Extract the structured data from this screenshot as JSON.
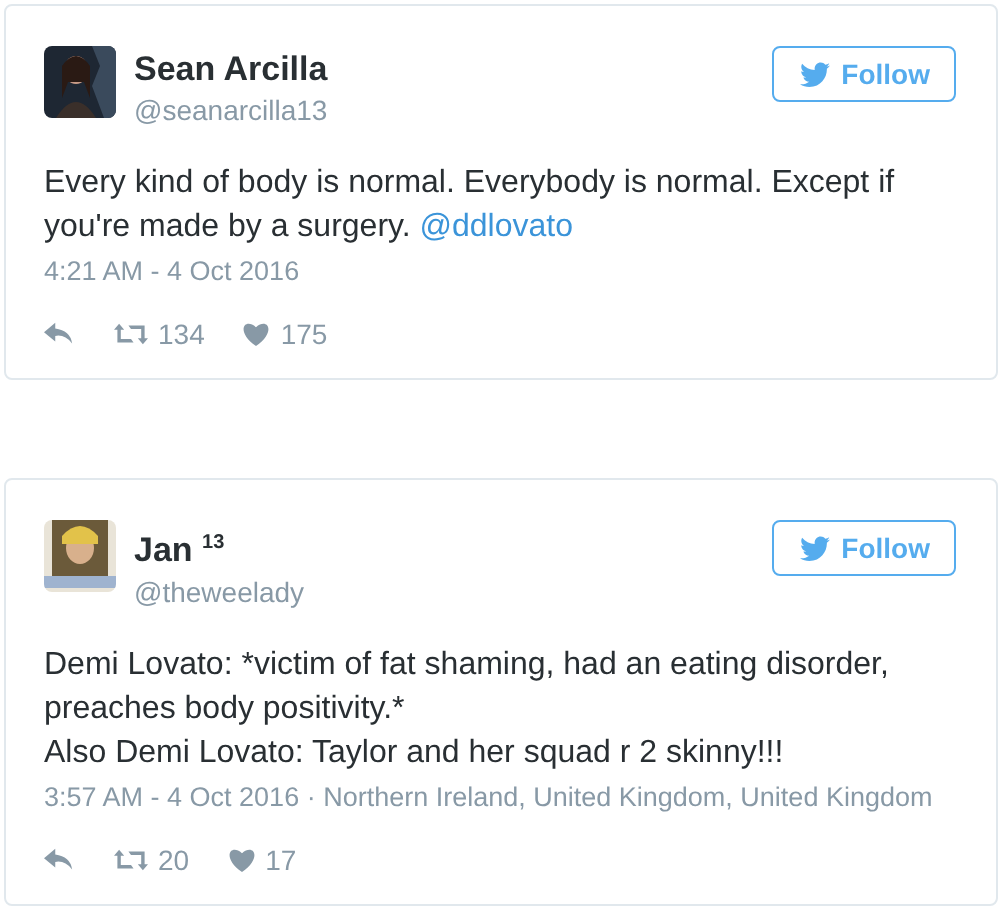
{
  "tweets": [
    {
      "name": "Sean Arcilla",
      "handle": "@seanarcilla13",
      "follow": "Follow",
      "paragraphs": [
        "Every kind of body is normal. Everybody is normal. Except if you're made by a surgery."
      ],
      "mention": "@ddlovato",
      "meta": "4:21 AM - 4 Oct 2016",
      "retweets": "134",
      "likes": "175"
    },
    {
      "name": "Jan $^{13}$",
      "handle": "@theweelady",
      "follow": "Follow",
      "paragraphs": [
        "Demi Lovato: *victim of fat shaming, had an eating disorder, preaches body positivity.*",
        "Also Demi Lovato: Taylor and her squad r 2 skinny!!!"
      ],
      "meta": "3:57 AM - 4 Oct 2016 · Northern Ireland, United Kingdom, United Kingdom",
      "retweets": "20",
      "likes": "17"
    }
  ]
}
